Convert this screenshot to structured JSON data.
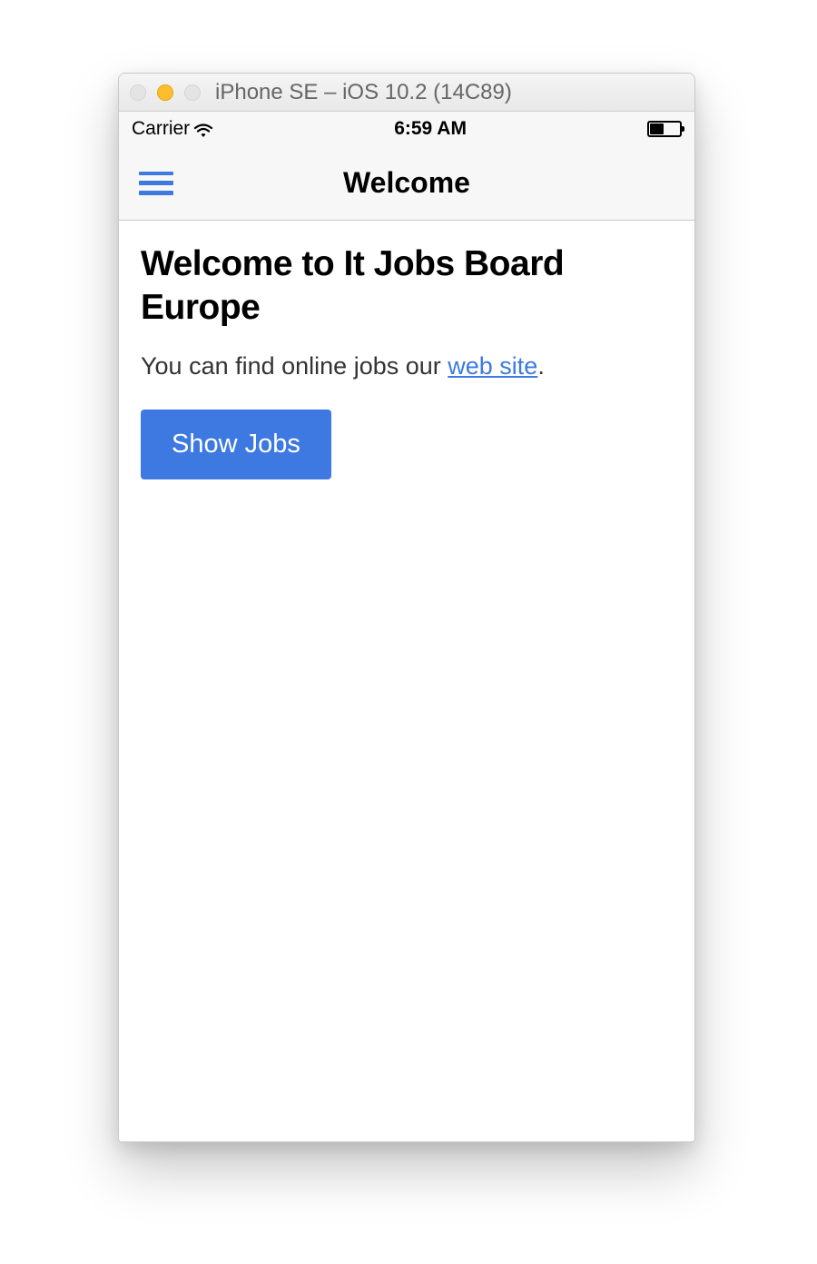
{
  "simulator": {
    "title": "iPhone SE – iOS 10.2 (14C89)"
  },
  "statusbar": {
    "carrier": "Carrier",
    "time": "6:59 AM"
  },
  "navbar": {
    "title": "Welcome"
  },
  "main": {
    "heading": "Welcome to It Jobs Board Europe",
    "subtext_prefix": "You can find online jobs our ",
    "link_label": "web site",
    "subtext_suffix": ".",
    "button_label": "Show Jobs"
  }
}
